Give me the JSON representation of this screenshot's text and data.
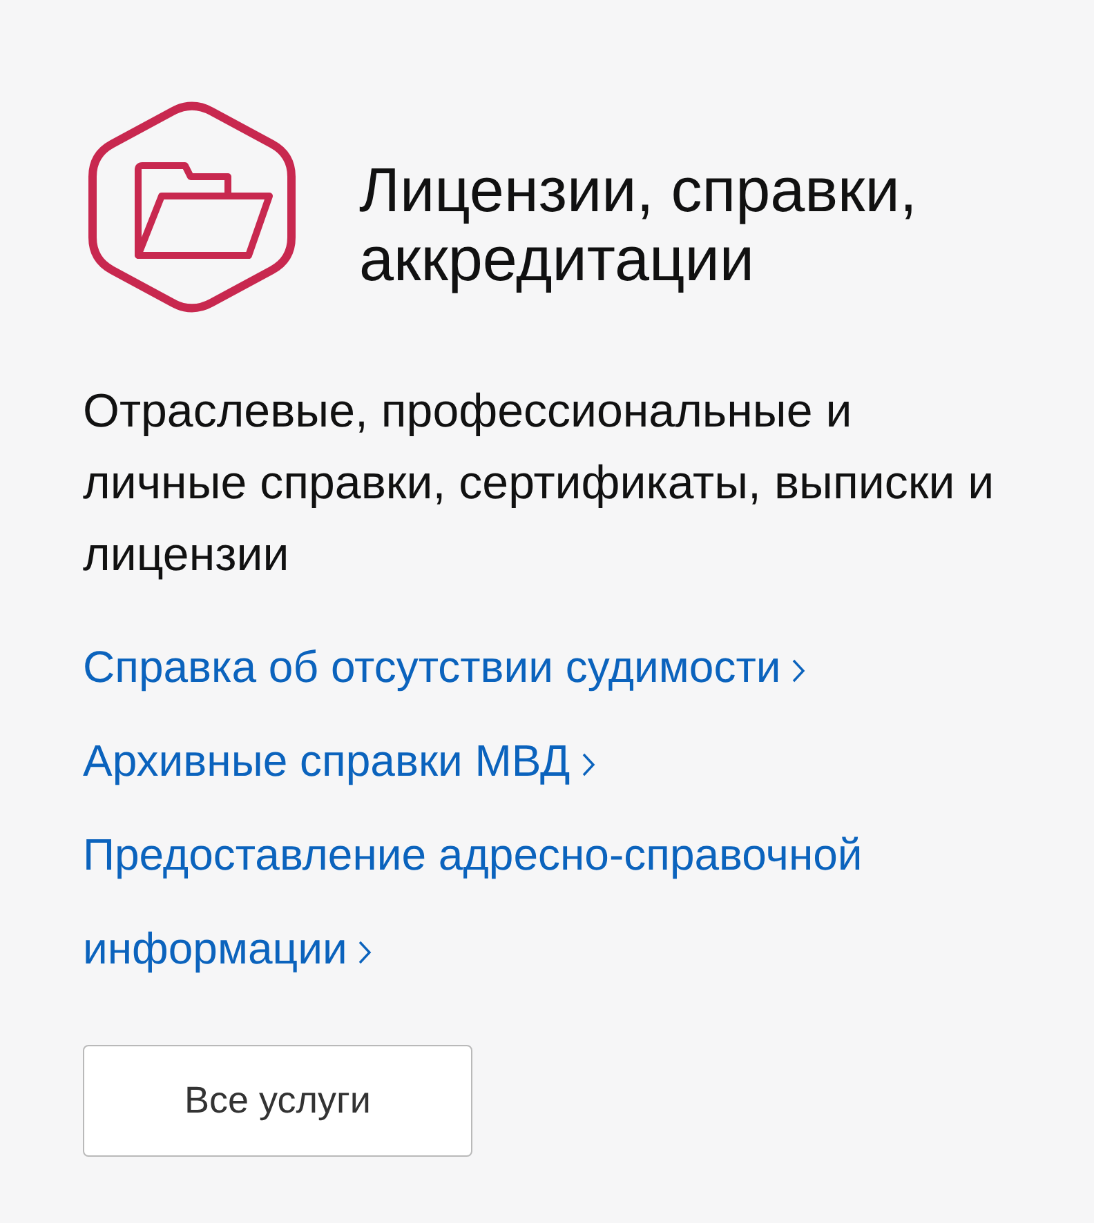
{
  "header": {
    "title": "Лицензии, справки, аккредитации"
  },
  "description": "Отраслевые, профессиональные и личные справки, сертификаты, выписки и лицензии",
  "links": [
    {
      "label": "Справка об отсутствии судимости"
    },
    {
      "label": "Архивные справки МВД"
    },
    {
      "label": "Предоставление адресно-справочной информации"
    }
  ],
  "button": {
    "label": "Все услуги"
  }
}
